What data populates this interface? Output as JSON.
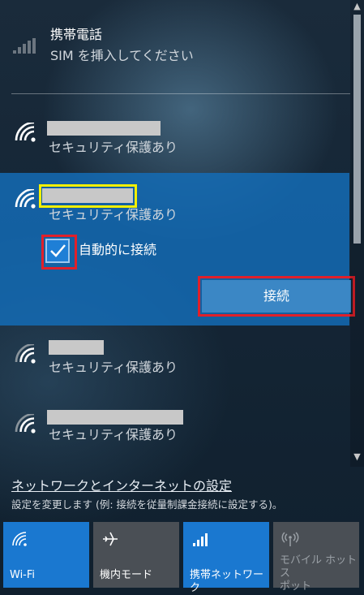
{
  "cellular": {
    "title": "携帯電話",
    "status": "SIM を挿入してください"
  },
  "networks": [
    {
      "status": "セキュリティ保護あり"
    },
    {
      "status": "セキュリティ保護あり",
      "auto_connect_label": "自動的に接続",
      "auto_connect_checked": true,
      "connect_label": "接続"
    },
    {
      "status": "セキュリティ保護あり"
    },
    {
      "status": "セキュリティ保護あり"
    }
  ],
  "settings": {
    "link": "ネットワークとインターネットの設定",
    "description": "設定を変更します (例: 接続を従量制課金接続に設定する)。"
  },
  "tiles": [
    {
      "label": "Wi-Fi",
      "icon": "wifi-icon",
      "active": true
    },
    {
      "label": "機内モード",
      "icon": "airplane-icon",
      "active": false
    },
    {
      "label": "携帯ネットワーク",
      "icon": "cellular-signal-icon",
      "active": true
    },
    {
      "label": "モバイル ホットスポット",
      "label_line1": "モバイル ホットス",
      "label_line2": "ポット",
      "icon": "hotspot-icon",
      "active": false,
      "disabled": true
    }
  ],
  "colors": {
    "accent": "#1a78d0",
    "tile_inactive": "#4a4f55",
    "highlight_yellow": "#f4f000",
    "highlight_red": "#e0202a"
  }
}
